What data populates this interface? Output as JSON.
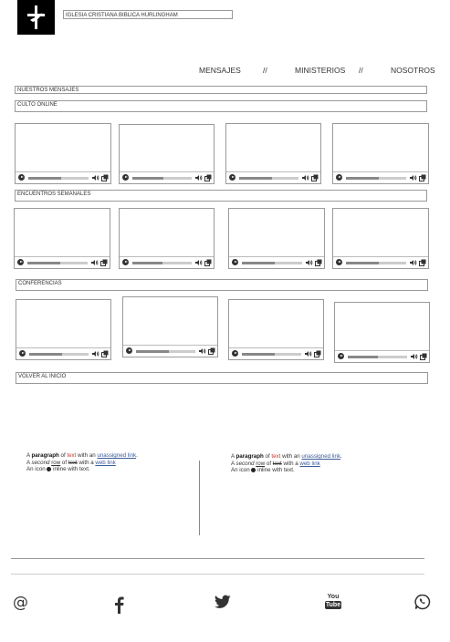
{
  "header": {
    "site_title": "IGLESIA CRISTIANA BIBLICA HURLINGHAM",
    "logo_icon": "cross-dove-logo-icon"
  },
  "nav": {
    "items": [
      {
        "label": "MENSAJES"
      },
      {
        "label": "//"
      },
      {
        "label": "MINISTERIOS"
      },
      {
        "label": "//"
      },
      {
        "label": "NOSOTROS"
      }
    ]
  },
  "sections": {
    "nuestros_mensajes": "NUESTROS MENSAJES",
    "culto_online": "CULTO ONLINE",
    "encuentros_semanales": "ENCUENTROS SEMANALES",
    "conferencias": "CONFERENCIAS",
    "volver": "VOLVER AL INICIO"
  },
  "videos": {
    "progress": [
      0.55,
      0.52,
      0.55,
      0.55,
      0.55,
      0.5,
      0.55,
      0.55,
      0.55,
      0.55,
      0.55,
      0.5,
      0.55,
      0.52,
      0.55,
      0.55
    ]
  },
  "footer_text": {
    "left": {
      "line1_a": "A ",
      "line1_b": "paragraph",
      "line1_c": " of ",
      "line1_d": "text",
      "line1_e": " with an ",
      "line1_f": "unassigned link",
      "line1_g": ".",
      "line2_a": "A ",
      "line2_b": "second",
      "line2_c": " ",
      "line2_d": "row",
      "line2_e": " of ",
      "line2_f": "text",
      "line2_g": " with a ",
      "line2_h": "web link",
      "line3_a": "An icon ",
      "line3_b": " inline with text."
    },
    "right": {
      "line1_a": "A ",
      "line1_b": "paragraph",
      "line1_c": " of ",
      "line1_d": "text",
      "line1_e": " with an ",
      "line1_f": "unassigned link",
      "line1_g": ".",
      "line2_a": "A ",
      "line2_b": "second",
      "line2_c": " ",
      "line2_d": "row",
      "line2_e": " of ",
      "line2_f": "text",
      "line2_g": " with a ",
      "line2_h": "web link",
      "line3_a": "An icon ",
      "line3_b": " inline with text."
    }
  },
  "social": {
    "icons": [
      "at-sign-icon",
      "facebook-icon",
      "twitter-icon",
      "youtube-icon",
      "whatsapp-icon"
    ],
    "youtube_top": "You",
    "youtube_bottom": "Tube"
  },
  "colors": {
    "accent_red": "#c0392b",
    "link_blue": "#3b5b9b"
  }
}
